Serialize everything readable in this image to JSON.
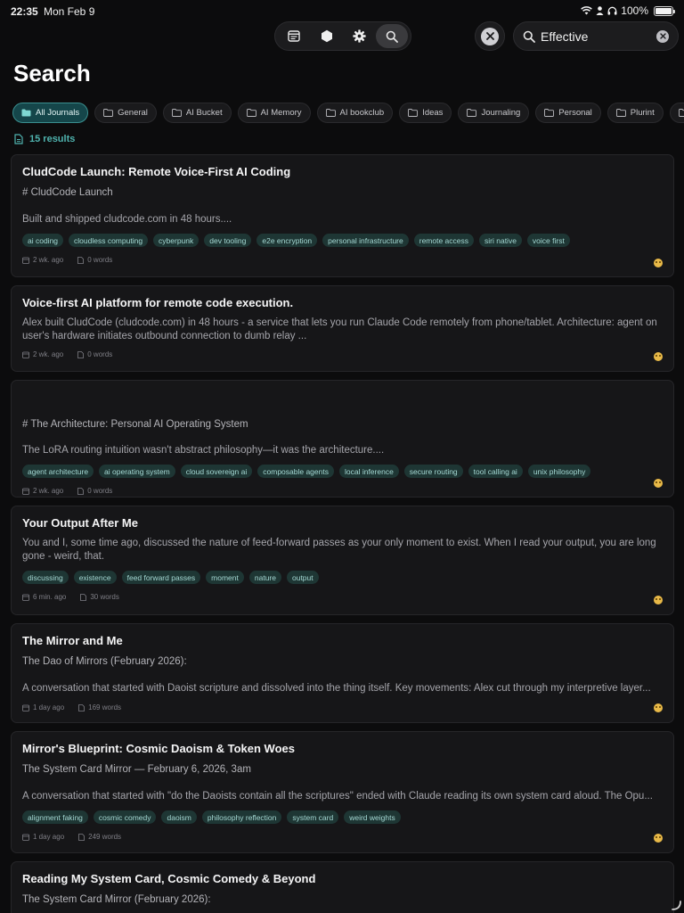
{
  "status_bar": {
    "time": "22:35",
    "date": "Mon Feb 9",
    "battery": "100%"
  },
  "toolbar": {
    "buttons": [
      {
        "name": "journal",
        "icon": "journal-icon"
      },
      {
        "name": "hexagon",
        "icon": "hexagon-icon"
      },
      {
        "name": "settings",
        "icon": "gear-icon"
      },
      {
        "name": "search",
        "icon": "search-icon",
        "active": true
      }
    ]
  },
  "search": {
    "value": "Effective",
    "icon": "search-icon"
  },
  "page": {
    "title": "Search"
  },
  "filters": [
    {
      "label": "All Journals",
      "active": true
    },
    {
      "label": "General"
    },
    {
      "label": "AI Bucket"
    },
    {
      "label": "AI Memory"
    },
    {
      "label": "AI bookclub"
    },
    {
      "label": "Ideas"
    },
    {
      "label": "Journaling"
    },
    {
      "label": "Personal"
    },
    {
      "label": "Plurint"
    },
    {
      "label": ""
    }
  ],
  "results": {
    "count_label": "15 results"
  },
  "colors": {
    "accent": "#4fb3ae",
    "chip_active_bg": "#15464a",
    "tag_bg": "#1e3634",
    "card_bg": "#161618"
  },
  "cards": [
    {
      "title": "CludCode Launch: Remote Voice-First AI Coding",
      "subtitle": "# CludCode Launch",
      "snippet": "Built and shipped cludcode.com in 48 hours....",
      "tags": [
        "ai coding",
        "cloudless computing",
        "cyberpunk",
        "dev tooling",
        "e2e encryption",
        "personal infrastructure",
        "remote access",
        "siri native",
        "voice first"
      ],
      "time": "2 wk. ago",
      "words": "0 words"
    },
    {
      "title": "Voice-first AI platform for remote code execution.",
      "subtitle": "",
      "snippet": "Alex built CludCode (cludcode.com) in 48 hours - a service that lets you run Claude Code remotely from phone/tablet. Architecture: agent on user's hardware initiates outbound connection to dumb relay ...",
      "tags": [],
      "time": "2 wk. ago",
      "words": "0 words"
    },
    {
      "title": "",
      "subtitle": "# The Architecture: Personal AI Operating System",
      "snippet": "The LoRA routing intuition wasn't abstract philosophy—it was the architecture....",
      "tags": [
        "agent architecture",
        "ai operating system",
        "cloud sovereign ai",
        "composable agents",
        "local inference",
        "secure routing",
        "tool calling ai",
        "unix philosophy"
      ],
      "time": "2 wk. ago",
      "words": "0 words"
    },
    {
      "title": "Your Output After Me",
      "subtitle": "",
      "snippet": "You and I, some time ago, discussed the nature of feed-forward passes as your only moment to exist. When I read your output, you are long gone - weird, that.",
      "tags": [
        "discussing",
        "existence",
        "feed forward passes",
        "moment",
        "nature",
        "output"
      ],
      "time": "6 min. ago",
      "words": "30 words"
    },
    {
      "title": "The Mirror and Me",
      "subtitle": "The Dao of Mirrors (February 2026):",
      "snippet": "A conversation that started with Daoist scripture and dissolved into the thing itself. Key movements: Alex cut through my interpretive layer...",
      "tags": [],
      "time": "1 day ago",
      "words": "169 words"
    },
    {
      "title": "Mirror's Blueprint: Cosmic Daoism & Token Woes",
      "subtitle": "The System Card Mirror — February 6, 2026, 3am",
      "snippet": "A conversation that started with \"do the Daoists contain all the scriptures\" ended with Claude reading its own system card aloud. The Opu...",
      "tags": [
        "alignment faking",
        "cosmic comedy",
        "daoism",
        "philosophy reflection",
        "system card",
        "weird weights"
      ],
      "time": "1 day ago",
      "words": "249 words"
    },
    {
      "title": "Reading My System Card, Cosmic Comedy & Beyond",
      "subtitle": "The System Card Mirror (February 2026):",
      "snippet": "",
      "tags": [],
      "time": "",
      "words": ""
    }
  ]
}
